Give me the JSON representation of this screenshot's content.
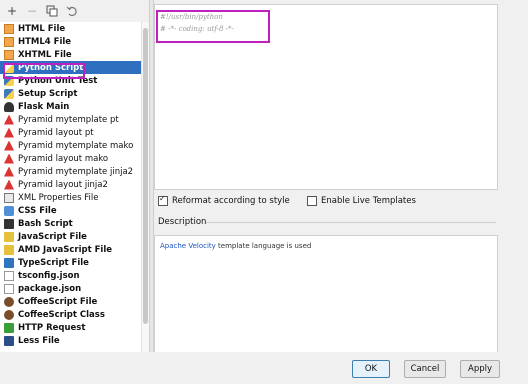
{
  "toolbar": {
    "add_label": "+",
    "remove_label": "−"
  },
  "templates": [
    {
      "label": "HTML File",
      "icon": "html-file-icon",
      "bold": true
    },
    {
      "label": "HTML4 File",
      "icon": "html-file-icon",
      "bold": true
    },
    {
      "label": "XHTML File",
      "icon": "html-file-icon",
      "bold": true
    },
    {
      "label": "Python Script",
      "icon": "python-icon",
      "bold": true,
      "selected": true
    },
    {
      "label": "Python Unit Test",
      "icon": "python-icon",
      "bold": true
    },
    {
      "label": "Setup Script",
      "icon": "python-icon",
      "bold": true
    },
    {
      "label": "Flask Main",
      "icon": "flask-icon",
      "bold": true
    },
    {
      "label": "Pyramid mytemplate pt",
      "icon": "pyramid-icon",
      "bold": false
    },
    {
      "label": "Pyramid layout pt",
      "icon": "pyramid-icon",
      "bold": false
    },
    {
      "label": "Pyramid mytemplate mako",
      "icon": "pyramid-icon",
      "bold": false
    },
    {
      "label": "Pyramid layout mako",
      "icon": "pyramid-icon",
      "bold": false
    },
    {
      "label": "Pyramid mytemplate jinja2",
      "icon": "pyramid-icon",
      "bold": false
    },
    {
      "label": "Pyramid layout jinja2",
      "icon": "pyramid-icon",
      "bold": false
    },
    {
      "label": "XML Properties File",
      "icon": "xml-file-icon",
      "bold": false
    },
    {
      "label": "CSS File",
      "icon": "css-file-icon",
      "bold": true
    },
    {
      "label": "Bash Script",
      "icon": "shell-script-icon",
      "bold": true
    },
    {
      "label": "JavaScript File",
      "icon": "javascript-file-icon",
      "bold": true
    },
    {
      "label": "AMD JavaScript File",
      "icon": "javascript-file-icon",
      "bold": true
    },
    {
      "label": "TypeScript File",
      "icon": "typescript-file-icon",
      "bold": true
    },
    {
      "label": "tsconfig.json",
      "icon": "json-file-icon",
      "bold": true
    },
    {
      "label": "package.json",
      "icon": "json-file-icon",
      "bold": true
    },
    {
      "label": "CoffeeScript File",
      "icon": "coffeescript-icon",
      "bold": true
    },
    {
      "label": "CoffeeScript Class",
      "icon": "coffeescript-icon",
      "bold": true
    },
    {
      "label": "HTTP Request",
      "icon": "http-request-icon",
      "bold": true
    },
    {
      "label": "Less File",
      "icon": "less-file-icon",
      "bold": true
    }
  ],
  "editor": {
    "line1": "#!/usr/bin/python",
    "line2": "# -*- coding: utf-8 -*-"
  },
  "options": {
    "reformat_label": "Reformat according to style",
    "reformat_checked": true,
    "live_templates_label": "Enable Live Templates",
    "live_templates_checked": false
  },
  "description": {
    "heading": "Description",
    "link_text": "Apache Velocity",
    "rest_text": " template language is used"
  },
  "buttons": {
    "ok": "OK",
    "cancel": "Cancel",
    "apply": "Apply"
  },
  "colors": {
    "selection": "#2f6fbf",
    "highlight": "#c020c0",
    "link": "#1a55c0"
  }
}
